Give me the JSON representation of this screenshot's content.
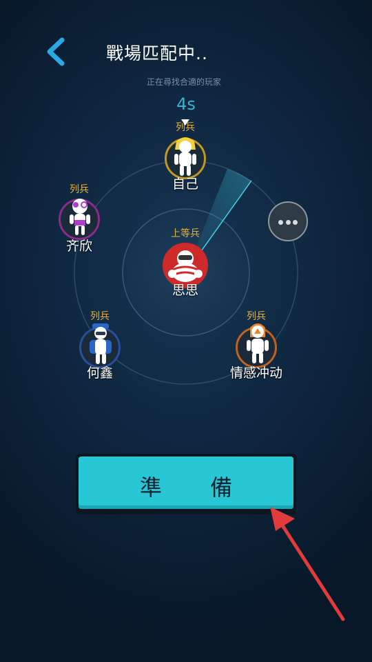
{
  "header": {
    "title": "戰場匹配中..",
    "subtitle": "正在尋找合適的玩家",
    "timer": "4s"
  },
  "players": [
    {
      "id": "self",
      "rank": "列兵",
      "name": "自己",
      "ring_color": "#c09a20"
    },
    {
      "id": "qixin",
      "rank": "列兵",
      "name": "齐欣",
      "ring_color": "#8a2b8e"
    },
    {
      "id": "sisi",
      "rank": "上等兵",
      "name": "思思",
      "ring_color": "#cf2a2a"
    },
    {
      "id": "hexin",
      "rank": "列兵",
      "name": "何鑫",
      "ring_color": "#2a4fa0"
    },
    {
      "id": "qinggan",
      "rank": "列兵",
      "name": "情感冲动",
      "ring_color": "#c0631c"
    }
  ],
  "more_button": {
    "icon": "more-dots-icon"
  },
  "ready_button": {
    "label": "準 備"
  },
  "colors": {
    "accent": "#27c7d5",
    "rank": "#e7b335",
    "timer": "#35b4d2",
    "annotation_arrow": "#e23b3b"
  }
}
